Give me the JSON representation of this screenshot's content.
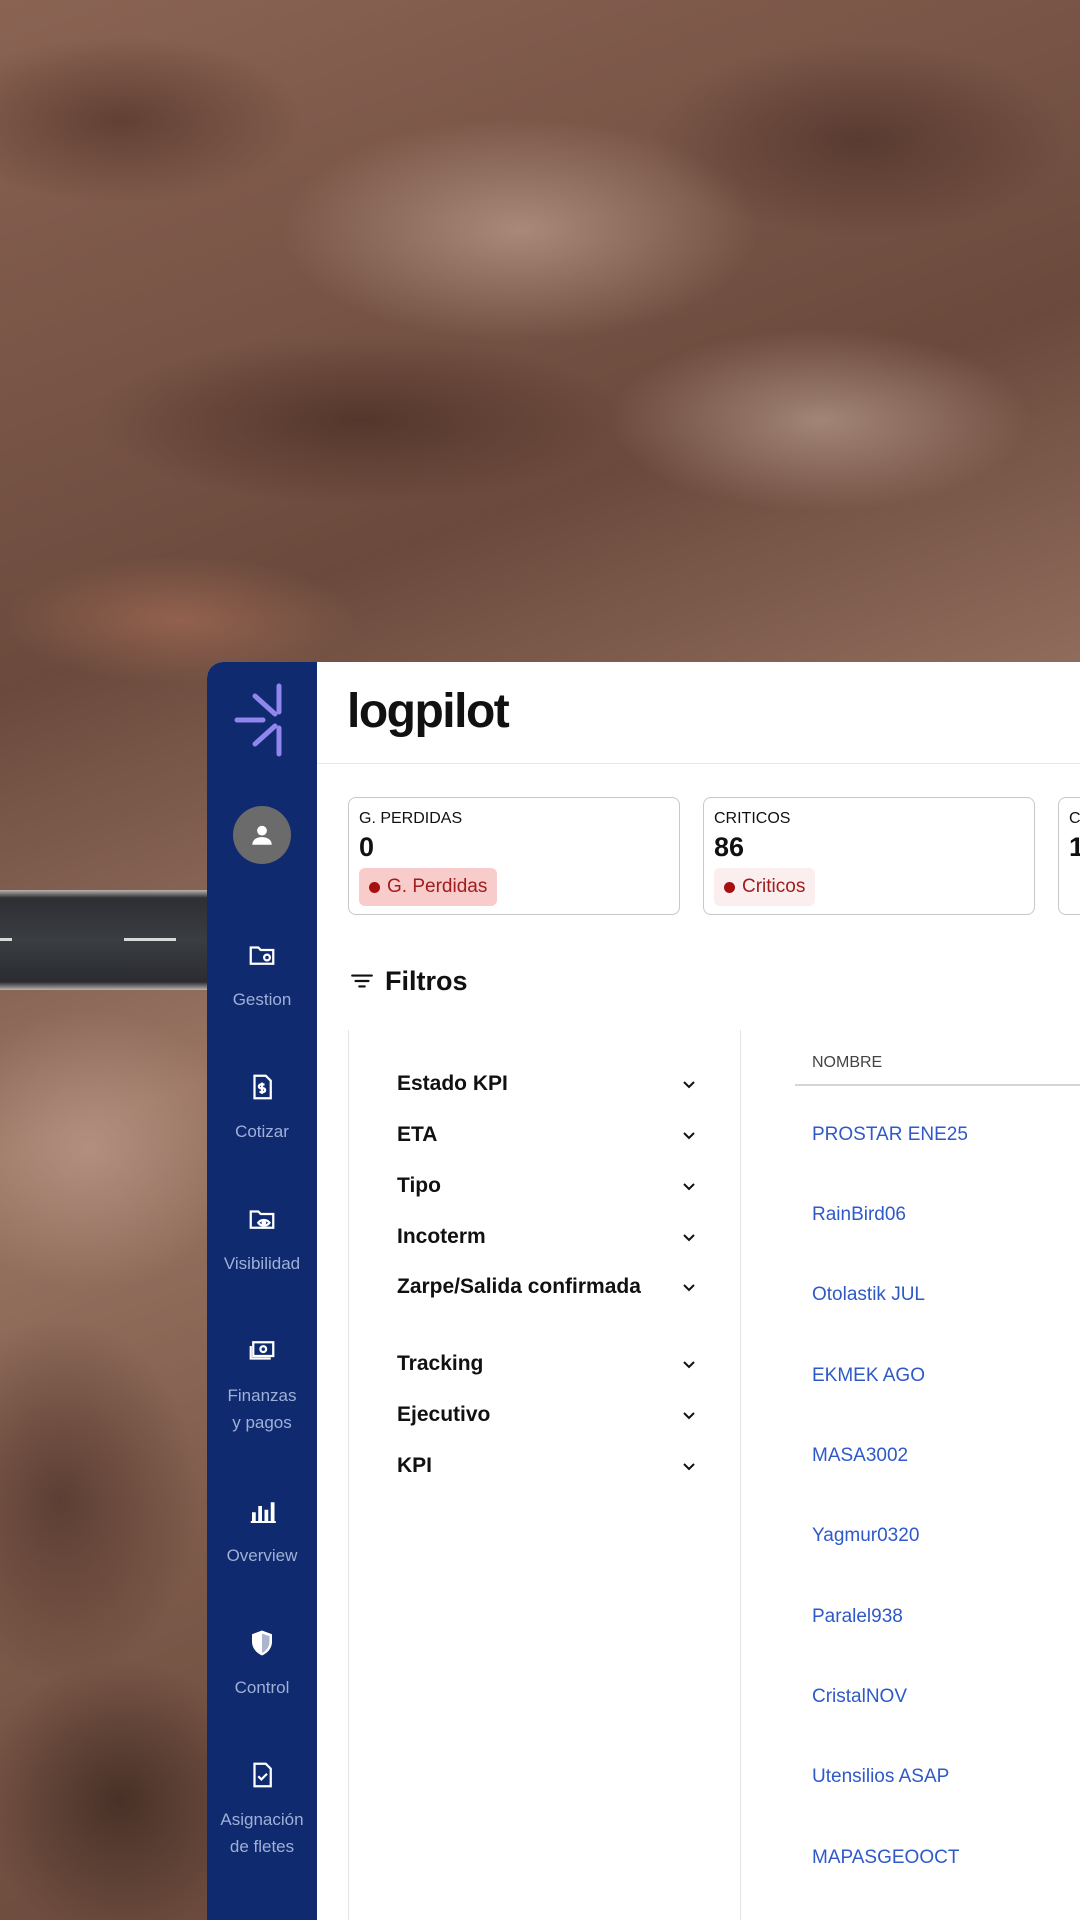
{
  "app": {
    "brand": "logpilot"
  },
  "sidebar": {
    "items": [
      {
        "label": "Gestion",
        "icon": "folder-gear-icon"
      },
      {
        "label": "Cotizar",
        "icon": "dollar-document-icon"
      },
      {
        "label": "Visibilidad",
        "icon": "folder-eye-icon"
      },
      {
        "label": "Finanzas\ny pagos",
        "icon": "money-icon"
      },
      {
        "label": "Overview",
        "icon": "bar-chart-icon"
      },
      {
        "label": "Control",
        "icon": "shield-icon"
      },
      {
        "label": "Asignación\nde fletes",
        "icon": "document-check-icon"
      }
    ]
  },
  "kpis": [
    {
      "label": "G. PERDIDAS",
      "value": "0",
      "badge": "G. Perdidas",
      "badge_bg": "#f9cccc"
    },
    {
      "label": "CRITICOS",
      "value": "86",
      "badge": "Criticos",
      "badge_bg": "#fbeeee"
    },
    {
      "label": "C",
      "value": "1",
      "badge": "",
      "badge_bg": "#fbeeee"
    }
  ],
  "filters": {
    "title": "Filtros",
    "items": [
      "Estado KPI",
      "ETA",
      "Tipo",
      "Incoterm",
      "Zarpe/Salida confirmada",
      "Tracking",
      "Ejecutivo",
      "KPI"
    ]
  },
  "table": {
    "column": "NOMBRE",
    "rows": [
      "PROSTAR ENE25",
      "RainBird06",
      "Otolastik JUL",
      "EKMEK AGO",
      "MASA3002",
      "Yagmur0320",
      "Paralel938",
      "CristalNOV",
      "Utensilios ASAP",
      "MAPASGEOOCT"
    ]
  },
  "colors": {
    "sidebar": "#0f2a6e",
    "accent": "#7b7fe0",
    "link": "#2f59c9",
    "danger": "#a61010"
  }
}
